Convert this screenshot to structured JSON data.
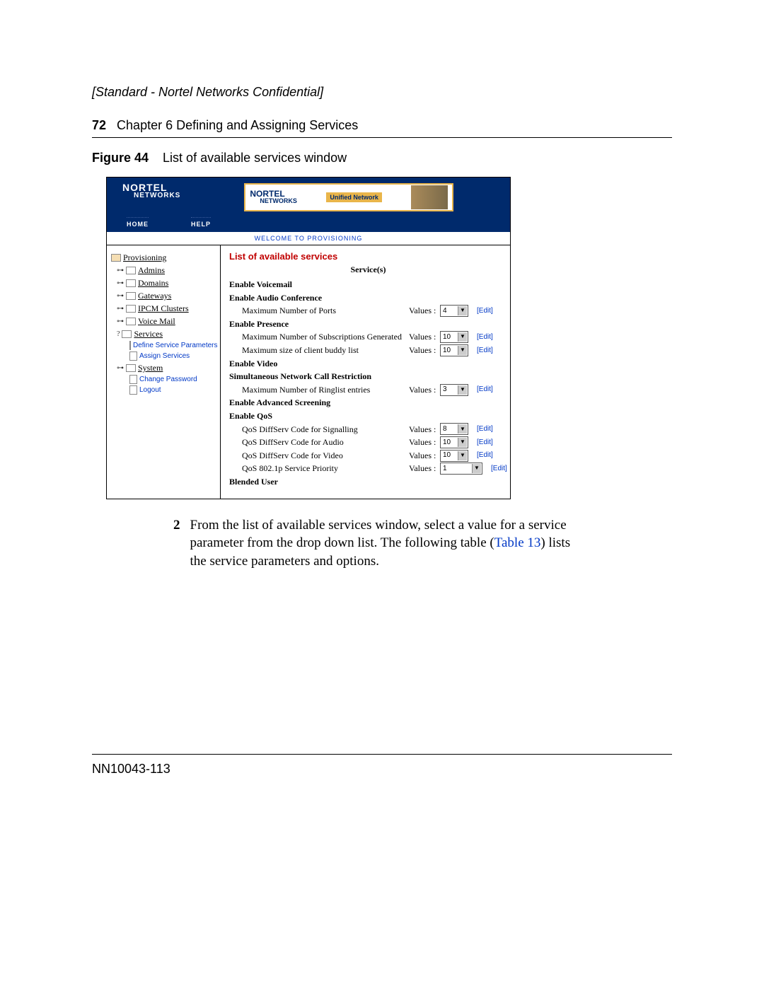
{
  "classification": "[Standard - Nortel Networks Confidential]",
  "page_number": "72",
  "chapter_label": "Chapter 6  Defining and Assigning Services",
  "figure_label": "Figure 44",
  "figure_caption": "List of available services window",
  "footer": "NN10043-113",
  "header_logo_top": "NORTEL",
  "header_logo_sub": "NETWORKS",
  "banner_tag": "Unified Network",
  "nav_home": "HOME",
  "nav_help": "HELP",
  "welcome": "WELCOME TO PROVISIONING",
  "sidebar": {
    "root": "Provisioning",
    "admins": "Admins",
    "domains": "Domains",
    "gateways": "Gateways",
    "ipcm": "IPCM Clusters",
    "voicemail": "Voice Mail",
    "services": "Services",
    "define_params": "Define Service Parameters",
    "assign": "Assign Services",
    "system": "System",
    "change_pwd": "Change Password",
    "logout": "Logout"
  },
  "panel": {
    "title": "List of available services",
    "col_header": "Service(s)",
    "enable_voicemail": "Enable Voicemail",
    "enable_audio_conf": "Enable Audio Conference",
    "max_ports": "Maximum Number of Ports",
    "enable_presence": "Enable Presence",
    "max_subs": "Maximum Number of Subscriptions Generated",
    "max_buddy": "Maximum size of client buddy list",
    "enable_video": "Enable Video",
    "sncr": "Simultaneous Network Call Restriction",
    "max_ringlist": "Maximum Number of Ringlist entries",
    "enable_adv_scr": "Enable Advanced Screening",
    "enable_qos": "Enable QoS",
    "qos_sig": "QoS DiffServ Code for Signalling",
    "qos_audio": "QoS DiffServ Code for Audio",
    "qos_video": "QoS DiffServ Code for Video",
    "qos_8021p": "QoS 802.1p Service Priority",
    "blended": "Blended User",
    "values_label": "Values :",
    "edit": "Edit",
    "v_ports": "4",
    "v_subs": "10",
    "v_buddy": "10",
    "v_ringlist": "3",
    "v_qos_sig": "8",
    "v_qos_audio": "10",
    "v_qos_video": "10",
    "v_8021p": "1"
  },
  "step": {
    "num": "2",
    "text_a": "From the list of available services window, select a value for a service parameter from the drop down list. The following table (",
    "table_ref": "Table 13",
    "text_b": ") lists the service parameters and options."
  }
}
